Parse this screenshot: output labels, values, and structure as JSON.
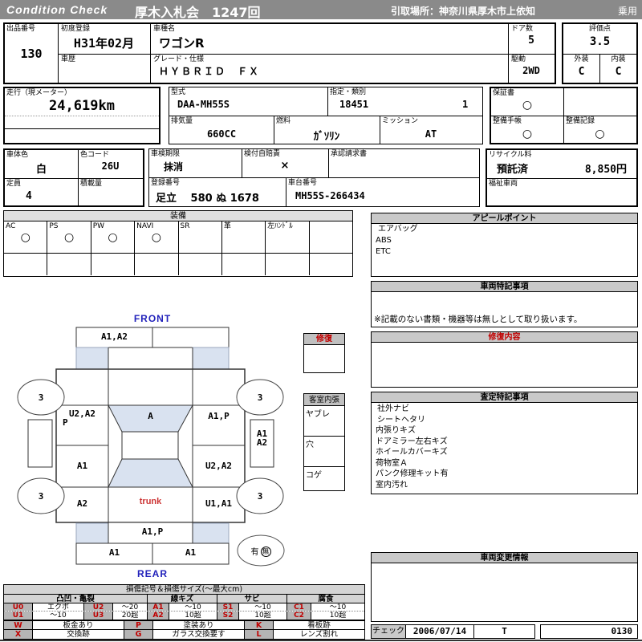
{
  "header": {
    "brand": "Condition  Check",
    "title": "厚木入札会　1247回",
    "pickup": "引取場所：神奈川県厚木市上依知",
    "usage": "乗用"
  },
  "info": {
    "lot_label": "出品番号",
    "lot_no": "130",
    "first_reg_label": "初度登録",
    "first_reg": "H31年02月",
    "history_label": "車歴",
    "history": "",
    "model_label": "車種名",
    "model": "ワゴンR",
    "grade_label": "グレード・仕様",
    "grade": "ＨＹＢＲＩＤ　ＦＸ",
    "doors_label": "ドア数",
    "doors": "5",
    "drive_label": "駆動",
    "drive": "2WD",
    "score_label": "評価点",
    "score": "3.5",
    "exterior_label": "外装",
    "exterior": "C",
    "interior_label": "内装",
    "interior": "C",
    "mileage_label": "走行（現メーター）",
    "mileage": "24,619km",
    "model_code_label": "型式",
    "model_code": "DAA-MH55S",
    "class_label": "指定・類別",
    "class_no": "18451",
    "class_sub": "1",
    "displacement_label": "排気量",
    "displacement": "660CC",
    "fuel_label": "燃料",
    "fuel": "ｶﾞｿﾘﾝ",
    "mission_label": "ミッション",
    "mission": "AT",
    "warranty_label": "保証書",
    "warranty": "○",
    "maint_book_label": "整備手帳",
    "maint_book": "○",
    "maint_record_label": "整備記録",
    "maint_record": "○",
    "color_label": "車体色",
    "color": "白",
    "color_code_label": "色コード",
    "color_code": "26U",
    "capacity_label": "定員",
    "capacity": "4",
    "load_label": "積載量",
    "load": "",
    "shaken_label": "車検期限",
    "shaken": "抹消",
    "insurance_label": "検付自賠責",
    "insurance": "×",
    "approval_label": "承認請求書",
    "approval": "",
    "reg_no_label": "登録番号",
    "reg_no": "足立　 580 ぬ 1678",
    "chassis_label": "車台番号",
    "chassis_no": "MH55S-266434",
    "recycle_label": "リサイクル料",
    "recycle_status": "預託済",
    "recycle_fee": "8,850円",
    "welfare_label": "福祉車両"
  },
  "equipment": {
    "title": "装備",
    "items": [
      {
        "label": "AC",
        "mark": "○"
      },
      {
        "label": "PS",
        "mark": "○"
      },
      {
        "label": "PW",
        "mark": "○"
      },
      {
        "label": "NAVI",
        "mark": "○"
      },
      {
        "label": "SR",
        "mark": ""
      },
      {
        "label": "革",
        "mark": ""
      },
      {
        "label": "左ﾊﾝﾄﾞﾙ",
        "mark": ""
      },
      {
        "label": "",
        "mark": ""
      }
    ]
  },
  "panels": {
    "appeal": {
      "title": "アピールポイント",
      "lines": [
        "エアバッグ",
        "ABS",
        "ETC"
      ]
    },
    "special": {
      "title": "車両特記事項",
      "note": "※記載のない書類・機器等は無しとして取り扱います。"
    },
    "repair": {
      "title": "修復内容"
    },
    "assessment": {
      "title": "査定特記事項",
      "lines": [
        "社外ナビ",
        "シートヘタリ",
        "内張りキズ",
        "ドアミラー左右キズ",
        "ホイールカバーキズ",
        "荷物室Ａ",
        "パンク修理キット有",
        "室内汚れ"
      ]
    },
    "change": {
      "title": "車両変更情報"
    },
    "check": {
      "label": "チェック",
      "date": "2006/07/14",
      "inspector": "T",
      "number": "0130"
    }
  },
  "side_boxes": {
    "repair_box": {
      "title": "修復"
    },
    "cabin_box": {
      "title": "客室内張",
      "row1": "ヤブレ",
      "row2": "穴",
      "row3": "コゲ"
    }
  },
  "diagram": {
    "front_label": "FRONT",
    "rear_label": "REAR",
    "front_bumper": "A1,A2",
    "left_fender_1": "U2,A2",
    "left_fender_2": "P",
    "windshield": "A",
    "right_fender": "A1,P",
    "left_door": "A1",
    "right_door": "U2,A2",
    "left_quarter": "A2",
    "trunk_label": "trunk",
    "right_quarter": "U1,A1",
    "right_rocker_1": "A1",
    "right_rocker_2": "A2",
    "rear_bumper": "A1,P",
    "rear_panel_left": "A1",
    "rear_panel_right": "A1",
    "wheel_fl": "3",
    "wheel_fr": "3",
    "wheel_rl": "3",
    "wheel_rr": "3",
    "spare_yes": "有",
    "spare_no": "無"
  },
  "legend": {
    "title": "損傷記号＆損傷サイズ(〜最大cm)",
    "g1": "凸凹・亀裂",
    "g2": "線キズ",
    "g3": "サビ",
    "g4": "腐食",
    "u0": "U0",
    "u0v": "エクボ",
    "u2": "U2",
    "u2v": "〜20",
    "u1": "U1",
    "u1v": "〜10",
    "u3": "U3",
    "u3v": "20超",
    "a1": "A1",
    "a1v": "〜10",
    "a2": "A2",
    "a2v": "10超",
    "s1": "S1",
    "s1v": "〜10",
    "s2": "S2",
    "s2v": "10超",
    "c1": "C1",
    "c1v": "〜10",
    "c2": "C2",
    "c2v": "10超",
    "w": "W",
    "wv": "板金あり",
    "p": "P",
    "pv": "塗装あり",
    "k": "K",
    "kv": "看板跡",
    "x": "X",
    "xv": "交換跡",
    "g": "G",
    "gv": "ガラス交換要す",
    "l": "L",
    "lv": "レンズ割れ"
  }
}
